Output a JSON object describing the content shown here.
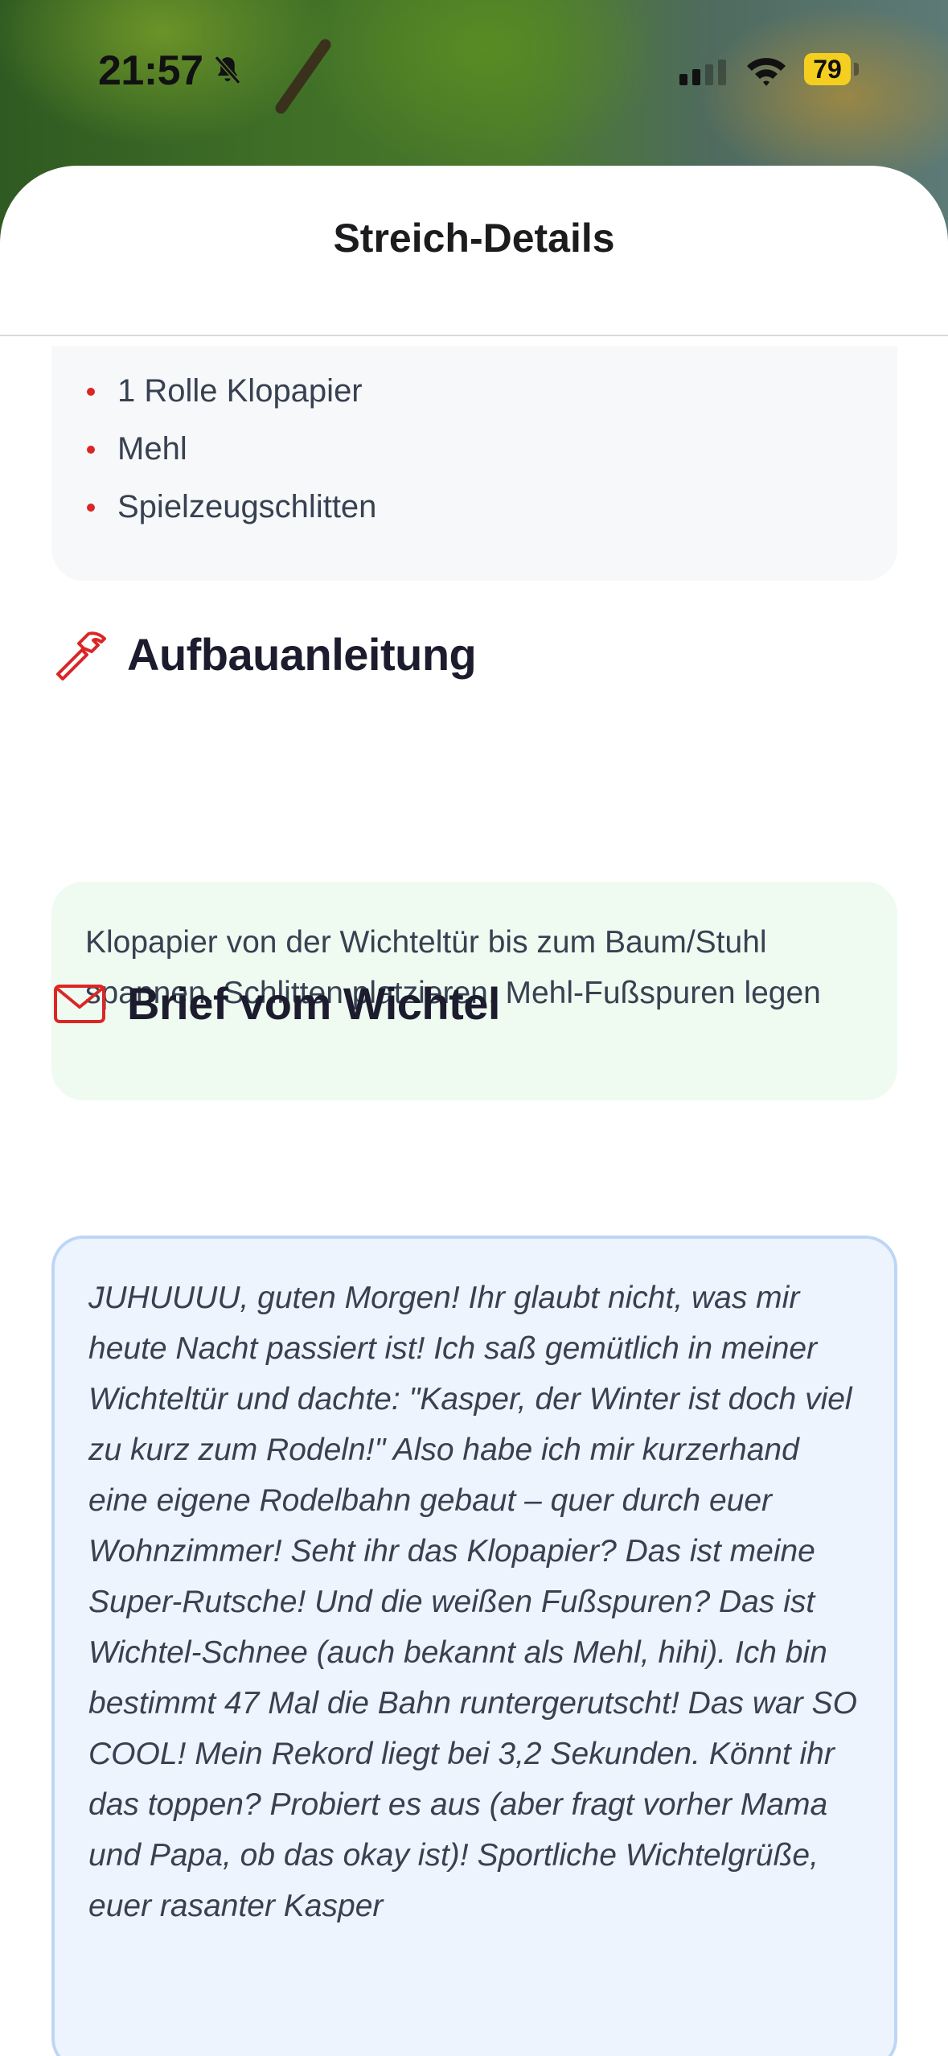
{
  "status_bar": {
    "time": "21:57",
    "battery": "79",
    "battery_color": "#f5cf1f"
  },
  "header": {
    "title": "Streich-Details"
  },
  "materials": {
    "items": [
      "1 Rolle Klopapier",
      "Mehl",
      "Spielzeugschlitten"
    ],
    "bullet_color": "#dc2626"
  },
  "instructions": {
    "heading": "Aufbauanleitung",
    "icon": "hammer-icon",
    "text": "Klopapier von der Wichteltür bis zum Baum/Stuhl spannen, Schlitten platzieren, Mehl-Fußspuren legen"
  },
  "letter": {
    "heading": "Brief vom Wichtel",
    "icon": "envelope-icon",
    "text": "JUHUUUU, guten Morgen! Ihr glaubt nicht, was mir heute Nacht passiert ist! Ich saß gemütlich in meiner Wichteltür und dachte: \"Kasper, der Winter ist doch viel zu kurz zum Rodeln!\" Also habe ich mir kurzerhand eine eigene Rodelbahn gebaut – quer durch euer Wohnzimmer! Seht ihr das Klopapier? Das ist meine Super-Rutsche! Und die weißen Fußspuren? Das ist Wichtel-Schnee (auch bekannt als Mehl, hihi). Ich bin bestimmt 47 Mal die Bahn runtergerutscht! Das war SO COOL! Mein Rekord liegt bei 3,2 Sekunden. Könnt ihr das toppen? Probiert es aus (aber fragt vorher Mama und Papa, ob das okay ist)! Sportliche Wichtelgrüße, euer rasanter Kasper"
  },
  "colors": {
    "accent_red": "#dc2626",
    "green_card": "#effbf1",
    "blue_card": "#eef4fd",
    "blue_border": "#bed6f5"
  }
}
